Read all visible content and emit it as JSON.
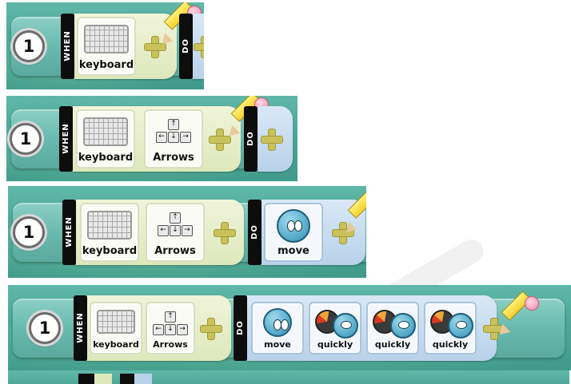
{
  "frames": [
    {
      "rule_number": "1",
      "when_label": "WHEN",
      "do_label": "DO",
      "conditions": [
        {
          "label": "keyboard",
          "icon": "keyboard-icon"
        }
      ],
      "actions": []
    },
    {
      "rule_number": "1",
      "when_label": "WHEN",
      "do_label": "DO",
      "conditions": [
        {
          "label": "keyboard",
          "icon": "keyboard-icon"
        },
        {
          "label": "Arrows",
          "icon": "arrow-keys-icon"
        }
      ],
      "actions": []
    },
    {
      "rule_number": "1",
      "when_label": "WHEN",
      "do_label": "DO",
      "conditions": [
        {
          "label": "keyboard",
          "icon": "keyboard-icon"
        },
        {
          "label": "Arrows",
          "icon": "arrow-keys-icon"
        }
      ],
      "actions": [
        {
          "label": "move",
          "icon": "move-face-icon"
        }
      ]
    },
    {
      "rule_number": "1",
      "when_label": "WHEN",
      "do_label": "DO",
      "conditions": [
        {
          "label": "keyboard",
          "icon": "keyboard-icon"
        },
        {
          "label": "Arrows",
          "icon": "arrow-keys-icon"
        }
      ],
      "actions": [
        {
          "label": "move",
          "icon": "move-face-icon"
        },
        {
          "label": "quickly",
          "icon": "speed-gauge-icon"
        },
        {
          "label": "quickly",
          "icon": "speed-gauge-icon"
        },
        {
          "label": "quickly",
          "icon": "speed-gauge-icon"
        }
      ]
    }
  ],
  "icons": {
    "add": "plus-icon",
    "edit": "pencil-icon"
  },
  "colors": {
    "panel_bg": "#4fa898",
    "when_segment": "#dde8bb",
    "do_segment": "#b8d2ea",
    "label_bar": "#0d0d0d",
    "plus": "#c9c25a"
  }
}
